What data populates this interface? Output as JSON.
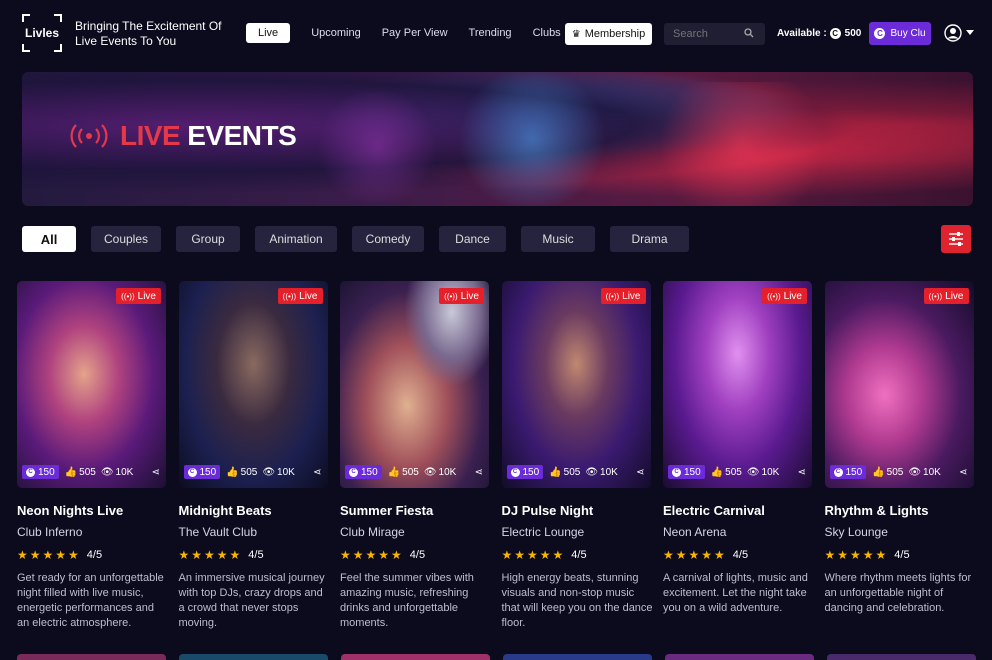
{
  "header": {
    "logo_text": "Livles",
    "tagline": "Bringing The Excitement Of Live Events To You",
    "nav": [
      "Live",
      "Upcoming",
      "Pay Per View",
      "Trending",
      "Clubs"
    ],
    "membership_label": "Membership",
    "search_placeholder": "Search",
    "available_label": "Available :",
    "available_value": "500",
    "buy_label": "Buy Clu"
  },
  "banner": {
    "title_red": "LIVE",
    "title_white": "EVENTS"
  },
  "filters": {
    "chips": [
      "All",
      "Couples",
      "Group",
      "Animation",
      "Comedy",
      "Dance",
      "Music",
      "Drama"
    ],
    "active": "All"
  },
  "cards": [
    {
      "title": "Neon Nights Live",
      "venue": "Club Inferno",
      "price": "150",
      "likes": "505",
      "views": "10K",
      "rating": "4/5",
      "badge": "Live",
      "description": "Get ready for an unforgettable night filled with live music, energetic performances and an electric atmosphere."
    },
    {
      "title": "Midnight Beats",
      "venue": "The Vault Club",
      "price": "150",
      "likes": "505",
      "views": "10K",
      "rating": "4/5",
      "badge": "Live",
      "description": "An immersive musical journey with top DJs, crazy drops and a crowd that never stops moving."
    },
    {
      "title": "Summer Fiesta",
      "venue": "Club Mirage",
      "price": "150",
      "likes": "505",
      "views": "10K",
      "rating": "4/5",
      "badge": "Live",
      "description": "Feel the summer vibes with amazing music, refreshing drinks and unforgettable moments."
    },
    {
      "title": "DJ Pulse Night",
      "venue": "Electric Lounge",
      "price": "150",
      "likes": "505",
      "views": "10K",
      "rating": "4/5",
      "badge": "Live",
      "description": "High energy beats, stunning visuals and non-stop music that will keep you on the dance floor."
    },
    {
      "title": "Electric Carnival",
      "venue": "Neon Arena",
      "price": "150",
      "likes": "505",
      "views": "10K",
      "rating": "4/5",
      "badge": "Live",
      "description": "A carnival of lights, music and excitement. Let the night take you on a wild adventure."
    },
    {
      "title": "Rhythm & Lights",
      "venue": "Sky Lounge",
      "price": "150",
      "likes": "505",
      "views": "10K",
      "rating": "4/5",
      "badge": "Live",
      "description": "Where rhythm meets lights for an unforgettable night of dancing and celebration."
    }
  ],
  "colors": {
    "background": "#0c0b1d",
    "accent_purple": "#6c2bd9",
    "live_red": "#e5202b",
    "star": "#f7b500"
  }
}
